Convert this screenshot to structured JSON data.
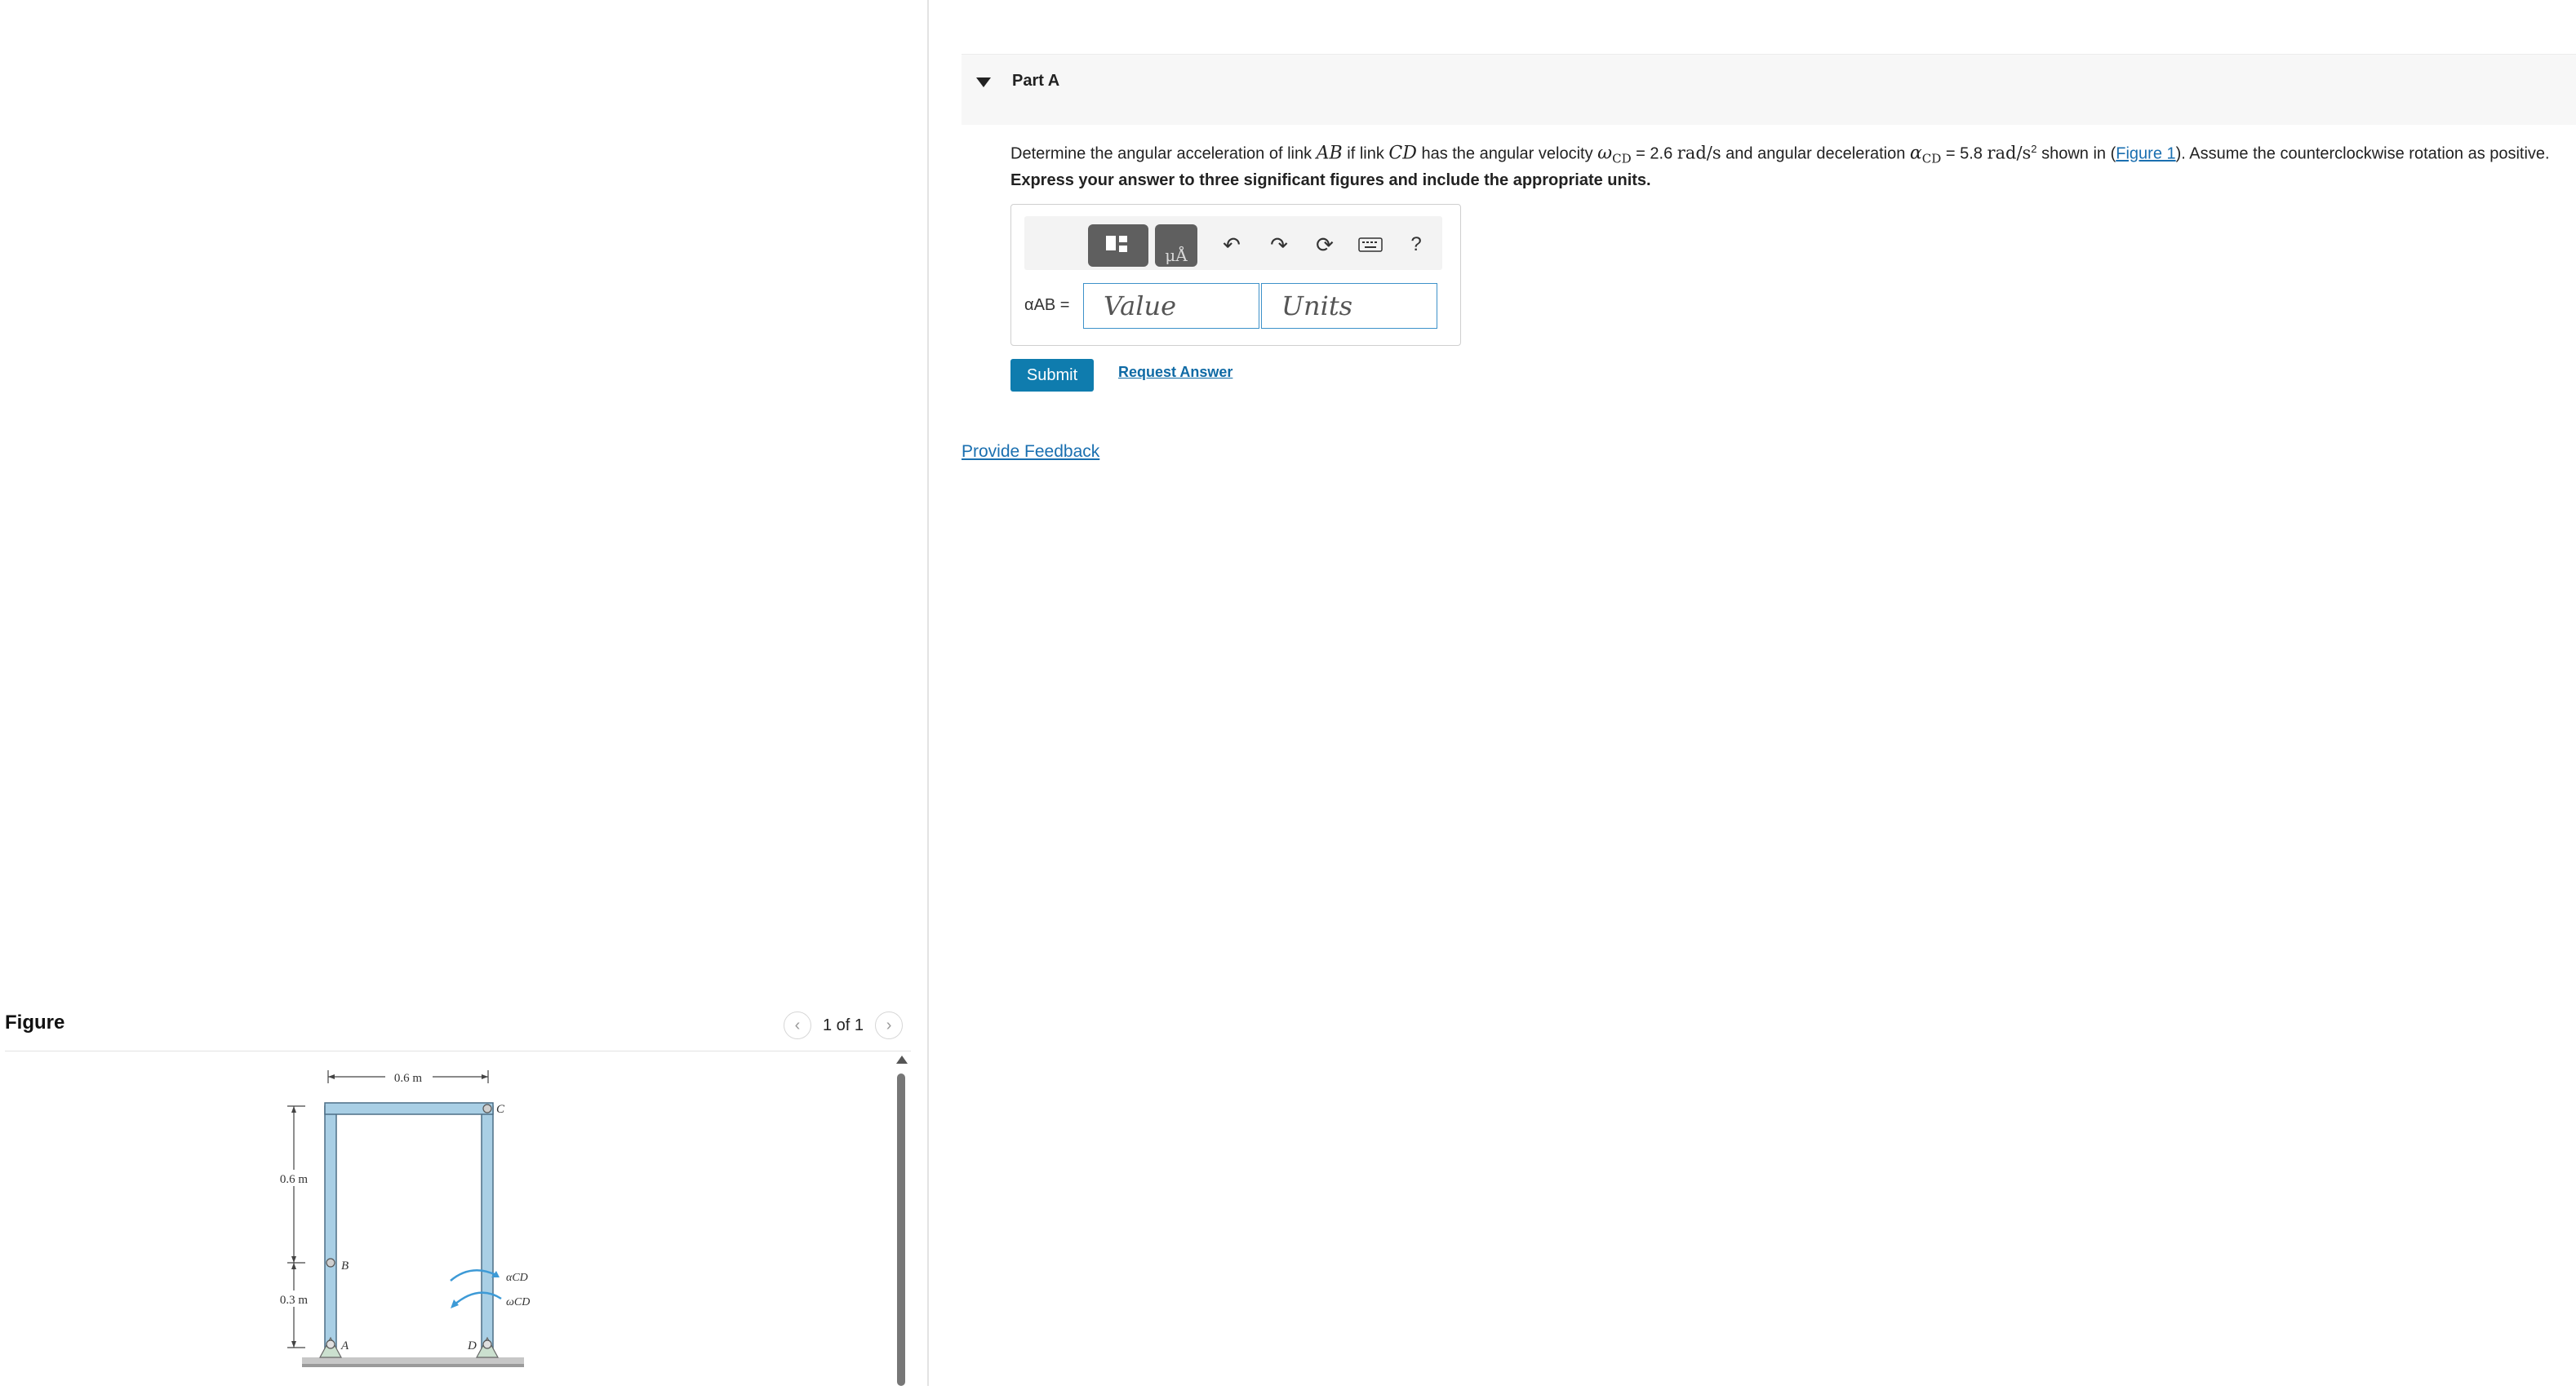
{
  "figure_panel": {
    "title": "Figure",
    "counter": "1 of 1",
    "prev_icon": "chevron-left-icon",
    "next_icon": "chevron-right-icon"
  },
  "figure_labels": {
    "width": "0.6 m",
    "height_upper": "0.6 m",
    "height_lower": "0.3 m",
    "point_a": "A",
    "point_b": "B",
    "point_c": "C",
    "point_d": "D",
    "alpha_cd": "αCD",
    "omega_cd": "ωCD"
  },
  "part": {
    "title": "Part A",
    "question": {
      "t1": "Determine the angular acceleration of link ",
      "m1": "AB",
      "t2": " if link ",
      "m2": "CD",
      "t3": " has the angular velocity ",
      "omega": "ω",
      "omega_sub": "CD",
      "t4": " = 2.6 ",
      "unit1": "rad/s",
      "t5": " and angular deceleration ",
      "alpha": "α",
      "alpha_sub": "CD",
      "t6": " = 5.8 ",
      "unit2": "rad/s",
      "unit2_exp": "2",
      "t7": " shown in (",
      "link": "Figure 1",
      "t8": "). Assume the counterclockwise rotation as positive."
    },
    "instruction": "Express your answer to three significant figures and include the appropriate units.",
    "answer_label": "αAB =",
    "value_placeholder": "Value",
    "units_placeholder": "Units",
    "units_tool_glyph": "μÅ",
    "help_glyph": "?",
    "submit": "Submit",
    "request_answer": "Request Answer"
  },
  "feedback": "Provide Feedback",
  "toolbar_icons": [
    "templates-icon",
    "units-icon",
    "undo-icon",
    "redo-icon",
    "reset-icon",
    "keyboard-icon",
    "help-icon"
  ]
}
